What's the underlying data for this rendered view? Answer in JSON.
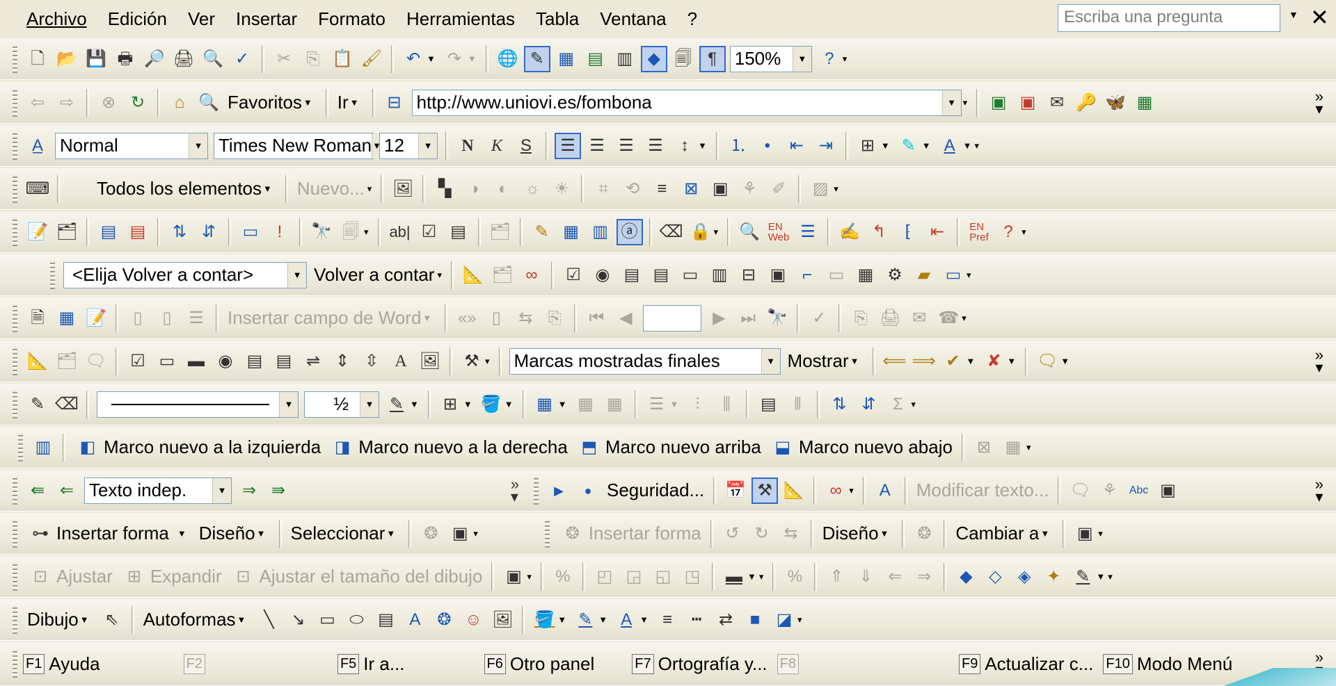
{
  "menu": {
    "items": [
      "Archivo",
      "Edición",
      "Ver",
      "Insertar",
      "Formato",
      "Herramientas",
      "Tabla",
      "Ventana",
      "?"
    ],
    "ask_placeholder": "Escriba una pregunta"
  },
  "standard": {
    "zoom": "150%"
  },
  "web": {
    "favorites": "Favoritos",
    "go": "Ir",
    "address": "http://www.uniovi.es/fombona"
  },
  "formatting": {
    "style": "Normal",
    "font": "Times New Roman",
    "size": "12",
    "bold": "N",
    "italic": "K",
    "underline": "S"
  },
  "controls_row": {
    "all_items": "Todos los elementos",
    "new": "Nuevo..."
  },
  "forms": {
    "text_field": "ab|"
  },
  "review_row": {
    "choose_return": "<Elija Volver a contar>",
    "return": "Volver a contar"
  },
  "mail_merge": {
    "insert_word_field": "Insertar campo de Word"
  },
  "tracking": {
    "markup": "Marcas mostradas finales",
    "show": "Mostrar"
  },
  "tables": {
    "line_weight": "½"
  },
  "frames": {
    "left": "Marco nuevo a la izquierda",
    "right": "Marco nuevo a la derecha",
    "top": "Marco nuevo arriba",
    "bottom": "Marco nuevo abajo"
  },
  "outline": {
    "level": "Texto indep.",
    "security": "Seguridad...",
    "modify_text": "Modificar texto..."
  },
  "diagram": {
    "insert_shape": "Insertar forma",
    "design": "Diseño",
    "select": "Seleccionar",
    "insert_shape2": "Insertar forma",
    "design2": "Diseño",
    "change_to": "Cambiar a"
  },
  "picture": {
    "fit": "Ajustar",
    "expand": "Expandir",
    "fit_drawing": "Ajustar el tamaño del dibujo"
  },
  "drawing": {
    "draw": "Dibujo",
    "autoshapes": "Autoformas"
  },
  "fkeys": [
    {
      "key": "F1",
      "label": "Ayuda"
    },
    {
      "key": "F2",
      "label": ""
    },
    {
      "key": "F5",
      "label": "Ir a..."
    },
    {
      "key": "F6",
      "label": "Otro panel"
    },
    {
      "key": "F7",
      "label": "Ortografía y..."
    },
    {
      "key": "F8",
      "label": ""
    },
    {
      "key": "F9",
      "label": "Actualizar c..."
    },
    {
      "key": "F10",
      "label": "Modo Menú"
    }
  ]
}
